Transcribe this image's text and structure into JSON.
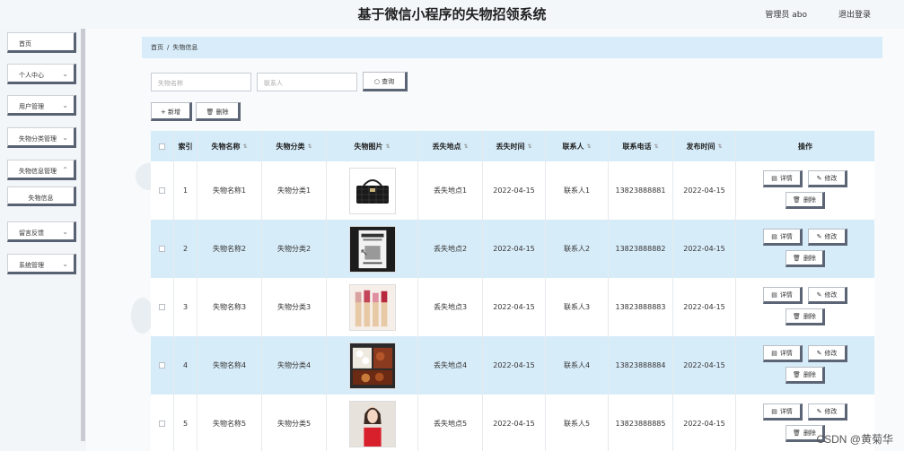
{
  "header": {
    "title": "基于微信小程序的失物招领系统",
    "admin_label": "管理员 abo",
    "logout_label": "退出登录"
  },
  "sidebar": {
    "items": [
      {
        "label": "首页",
        "expandable": false
      },
      {
        "label": "个人中心",
        "expandable": true
      },
      {
        "label": "用户管理",
        "expandable": true
      },
      {
        "label": "失物分类管理",
        "expandable": true
      },
      {
        "label": "失物信息管理",
        "expandable": true
      },
      {
        "label": "留言反馈",
        "expandable": true
      },
      {
        "label": "系统管理",
        "expandable": true
      }
    ],
    "sub_item": "失物信息"
  },
  "breadcrumb": {
    "home": "首页",
    "separator": "/",
    "current": "失物信息"
  },
  "search": {
    "name_placeholder": "失物名称",
    "contact_placeholder": "联系人",
    "query_label": "查询"
  },
  "actions": {
    "add_label": "新增",
    "delete_label": "删除"
  },
  "table": {
    "headers": {
      "index": "索引",
      "name": "失物名称",
      "category": "失物分类",
      "image": "失物图片",
      "location": "丢失地点",
      "time": "丢失时间",
      "contact": "联系人",
      "phone": "联系电话",
      "publish": "发布时间",
      "ops": "操作"
    },
    "op_labels": {
      "detail": "详情",
      "edit": "修改",
      "delete": "删除"
    },
    "rows": [
      {
        "index": "1",
        "name": "失物名称1",
        "category": "失物分类1",
        "image": "handbag",
        "location": "丢失地点1",
        "time": "2022-04-15",
        "contact": "联系人1",
        "phone": "13823888881",
        "publish": "2022-04-15"
      },
      {
        "index": "2",
        "name": "失物名称2",
        "category": "失物分类2",
        "image": "book",
        "location": "丢失地点2",
        "time": "2022-04-15",
        "contact": "联系人2",
        "phone": "13823888882",
        "publish": "2022-04-15"
      },
      {
        "index": "3",
        "name": "失物名称3",
        "category": "失物分类3",
        "image": "lipsticks",
        "location": "丢失地点3",
        "time": "2022-04-15",
        "contact": "联系人3",
        "phone": "13823888883",
        "publish": "2022-04-15"
      },
      {
        "index": "4",
        "name": "失物名称4",
        "category": "失物分类4",
        "image": "food-box",
        "location": "丢失地点4",
        "time": "2022-04-15",
        "contact": "联系人4",
        "phone": "13823888884",
        "publish": "2022-04-15"
      },
      {
        "index": "5",
        "name": "失物名称5",
        "category": "失物分类5",
        "image": "person-photo",
        "location": "丢失地点5",
        "time": "2022-04-15",
        "contact": "联系人5",
        "phone": "13823888885",
        "publish": "2022-04-15"
      }
    ]
  },
  "watermark": "CSDN @黄菊华",
  "colors": {
    "accent_light": "#d7ecf9",
    "button_shadow": "#5c6575"
  }
}
